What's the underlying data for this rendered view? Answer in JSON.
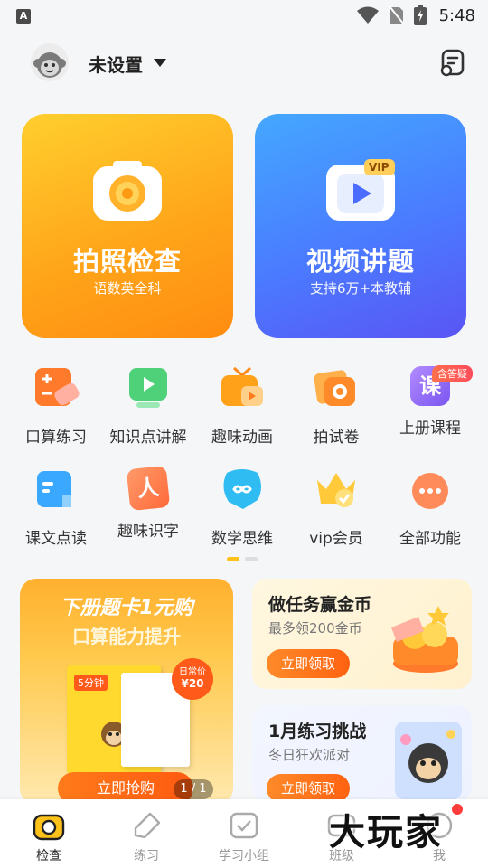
{
  "status_bar": {
    "time": "5:48",
    "badge": "A"
  },
  "header": {
    "username": "未设置"
  },
  "big_cards": [
    {
      "title": "拍照检查",
      "subtitle": "语数英全科"
    },
    {
      "title": "视频讲题",
      "subtitle": "支持6万+本教辅",
      "tag": "VIP"
    }
  ],
  "grid_items": [
    {
      "label": "口算练习",
      "icon": "calculator-icon"
    },
    {
      "label": "知识点讲解",
      "icon": "video-lesson-icon"
    },
    {
      "label": "趣味动画",
      "icon": "tv-icon"
    },
    {
      "label": "拍试卷",
      "icon": "camera-paper-icon"
    },
    {
      "label": "上册课程",
      "icon": "course-icon",
      "glyph": "课"
    },
    {
      "label": "课文点读",
      "icon": "read-icon"
    },
    {
      "label": "趣味识字",
      "icon": "character-icon",
      "glyph": "人"
    },
    {
      "label": "数学思维",
      "icon": "thinking-icon"
    },
    {
      "label": "vip会员",
      "icon": "crown-icon"
    },
    {
      "label": "全部功能",
      "icon": "more-icon"
    }
  ],
  "grid_badge": "含答疑",
  "promo": {
    "title": "下册题卡1元购",
    "subtitle": "口算能力提升",
    "price_tag_line1": "日常价",
    "price_tag_line2": "¥20",
    "book_label": "5分钟",
    "button": "立即抢购",
    "page_indicator": "1 / 1"
  },
  "right_cards": [
    {
      "title": "做任务赢金币",
      "subtitle": "最多领200金币",
      "button": "立即领取"
    },
    {
      "title": "1月练习挑战",
      "subtitle": "冬日狂欢派对",
      "button": "立即领取"
    }
  ],
  "tabs": [
    {
      "label": "检查",
      "active": true
    },
    {
      "label": "练习",
      "active": false
    },
    {
      "label": "学习小组",
      "active": false
    },
    {
      "label": "班级",
      "active": false
    },
    {
      "label": "我",
      "active": false
    }
  ],
  "watermark": "大玩家",
  "colors": {
    "orange": "#ffa61a",
    "blue": "#4a7bff",
    "accent": "#ff6210"
  }
}
